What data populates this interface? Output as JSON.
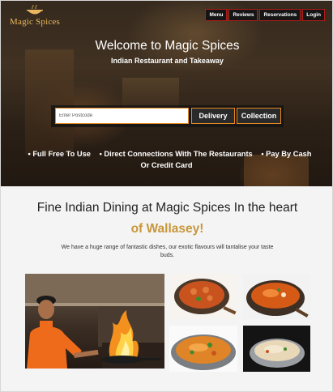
{
  "brand": {
    "name": "Magic Spices"
  },
  "nav": {
    "items": [
      {
        "label": "Menu"
      },
      {
        "label": "Reviews"
      },
      {
        "label": "Reservations"
      },
      {
        "label": "Login"
      }
    ]
  },
  "hero": {
    "title": "Welcome to Magic Spices",
    "subtitle": "Indian Restaurant and Takeaway"
  },
  "search": {
    "placeholder": "Enter Postcode",
    "delivery_label": "Delivery",
    "collection_label": "Collection"
  },
  "features": {
    "items": [
      "• Full Free To Use",
      "• Direct Connections With The Restaurants",
      "• Pay By Cash Or Credit Card"
    ]
  },
  "intro": {
    "heading": "Fine Indian Dining at Magic Spices In the heart",
    "heading_highlight": "of Wallasey!",
    "description": "We have a huge range of fantastic dishes, our exotic flavours will tantalise your taste buds."
  },
  "colors": {
    "accent_orange": "#e58a1f",
    "gold": "#c7973b",
    "nav_border": "#b01a1a"
  }
}
